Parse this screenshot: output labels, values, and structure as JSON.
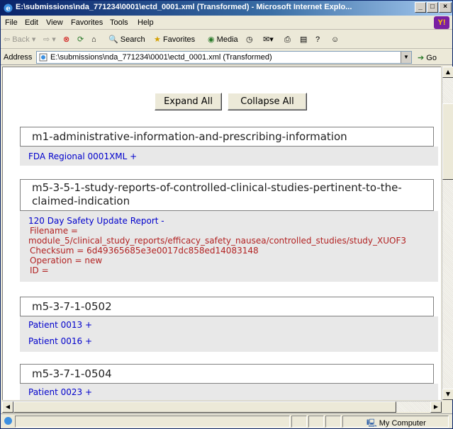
{
  "window": {
    "title": "E:\\submissions\\nda_771234\\0001\\ectd_0001.xml (Transformed) - Microsoft Internet Explo..."
  },
  "menu": [
    "File",
    "Edit",
    "View",
    "Favorites",
    "Tools",
    "Help"
  ],
  "toolbar": {
    "back": "Back",
    "search": "Search",
    "favorites": "Favorites",
    "media": "Media"
  },
  "address": {
    "label": "Address",
    "value": "E:\\submissions\\nda_771234\\0001\\ectd_0001.xml (Transformed)",
    "go": "Go"
  },
  "buttons": {
    "expand_all": "Expand All",
    "collapse_all": "Collapse All"
  },
  "sections": {
    "m1": {
      "heading": "m1-administrative-information-and-prescribing-information",
      "items": [
        "FDA Regional 0001XML +"
      ]
    },
    "m5351": {
      "heading_line1": "m5-3-5-1-study-reports-of-controlled-clinical-studies-pertinent-to-the-",
      "heading_line2": "claimed-indication",
      "item": "120 Day Safety Update Report -",
      "detail": {
        "filename_label": "Filename =",
        "filename_value": "module_5/clinical_study_reports/efficacy_safety_nausea/controlled_studies/study_XUOF3",
        "checksum": "Checksum = 6d49365685e3e0017dc858ed14083148",
        "operation": "Operation = new",
        "id": "ID ="
      }
    },
    "m5_0502": {
      "heading": "m5-3-7-1-0502",
      "items": [
        "Patient 0013 +",
        "Patient 0016 +"
      ]
    },
    "m5_0504": {
      "heading": "m5-3-7-1-0504",
      "items": [
        "Patient 0023 +"
      ]
    }
  },
  "status": {
    "zone": "My Computer"
  },
  "colors": {
    "link": "#0000cc",
    "detail": "#b22222",
    "band": "#e8e8e8",
    "titlebar": "#0a246a"
  }
}
